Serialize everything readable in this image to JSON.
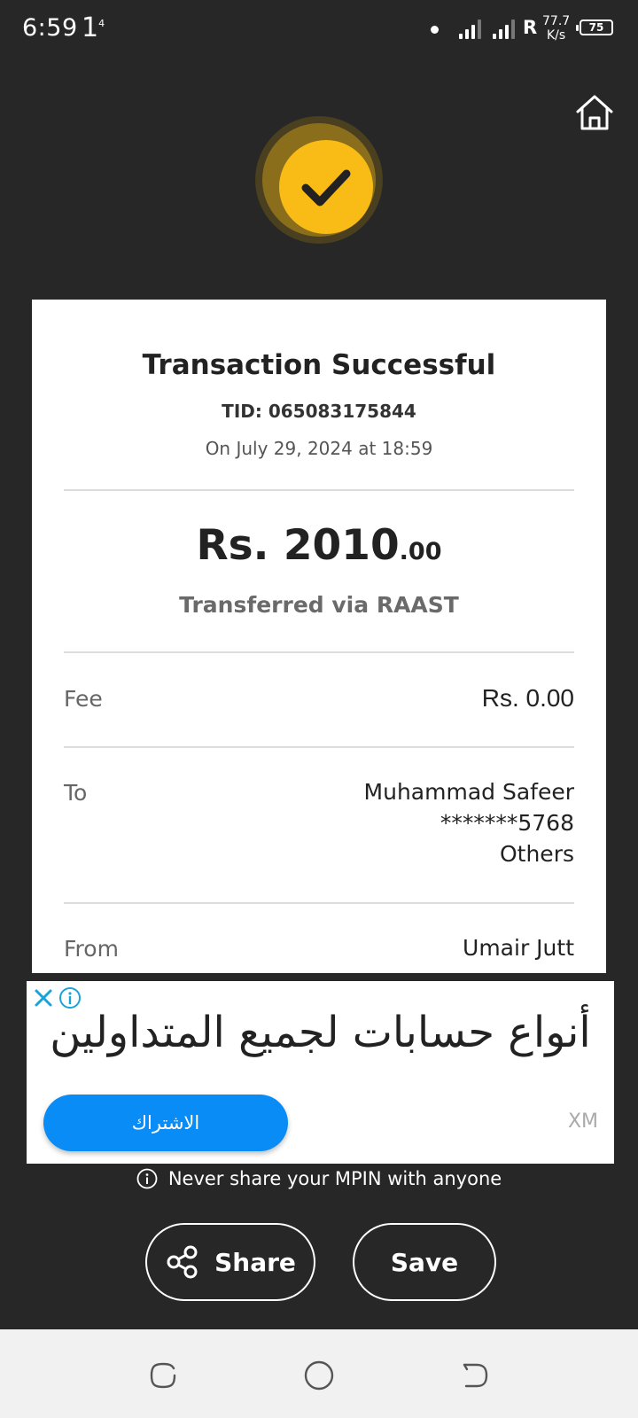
{
  "status_bar": {
    "time": "6:59",
    "extra": "1",
    "extra_sup": "4",
    "carrier": "R",
    "speed_value": "77.7",
    "speed_unit": "K/s",
    "battery": "75"
  },
  "receipt": {
    "title": "Transaction Successful",
    "tid": "TID: 065083175844",
    "date": "On July 29, 2024 at 18:59",
    "amount_main": "Rs. 2010",
    "amount_decimal": ".00",
    "via": "Transferred via RAAST",
    "fee_label": "Fee",
    "fee_value": "Rs. 0.00",
    "to_label": "To",
    "to_name": "Muhammad Safeer",
    "to_account": "*******5768",
    "to_bank": "Others",
    "from_label": "From",
    "from_name": "Umair Jutt"
  },
  "ad": {
    "headline": "أنواع حسابات لجميع المتداولين",
    "cta": "الاشتراك",
    "brand": "XM"
  },
  "notice": "Never share your MPIN with anyone",
  "actions": {
    "share": "Share",
    "save": "Save"
  },
  "colors": {
    "background": "#272727",
    "accent_yellow": "#f9bb16",
    "ad_button": "#0a8cf7"
  }
}
